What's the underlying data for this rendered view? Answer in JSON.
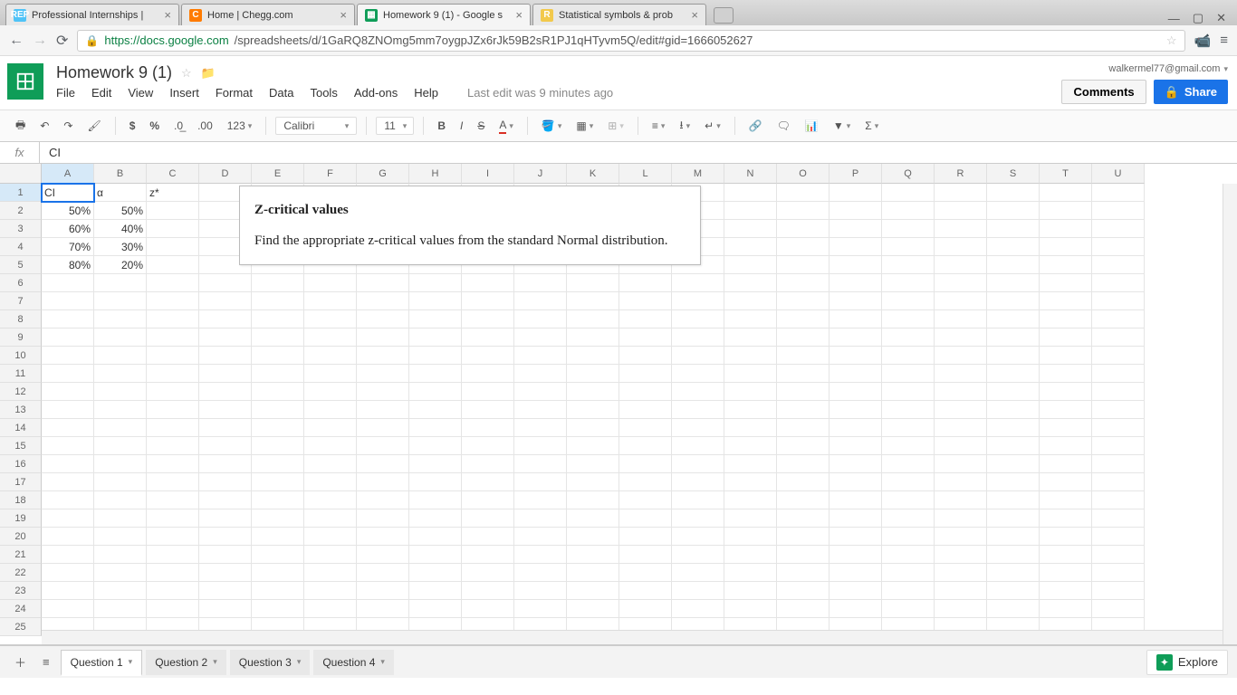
{
  "browser": {
    "tabs": [
      {
        "favicon_bg": "#4fc3f7",
        "favicon_text": "REP",
        "title": "Professional Internships |"
      },
      {
        "favicon_bg": "#ff7b00",
        "favicon_text": "C",
        "title": "Home | Chegg.com"
      },
      {
        "favicon_bg": "#0f9d58",
        "favicon_text": "▦",
        "title": "Homework 9 (1) - Google s",
        "active": true
      },
      {
        "favicon_bg": "#f2c94c",
        "favicon_text": "R",
        "title": "Statistical symbols & prob"
      }
    ],
    "url_domain": "https://docs.google.com",
    "url_path": "/spreadsheets/d/1GaRQ8ZNOmg5mm7oygpJZx6rJk59B2sR1PJ1qHTyvm5Q/edit#gid=1666052627"
  },
  "doc": {
    "title": "Homework 9 (1)",
    "menus": [
      "File",
      "Edit",
      "View",
      "Insert",
      "Format",
      "Data",
      "Tools",
      "Add-ons",
      "Help"
    ],
    "last_edit": "Last edit was 9 minutes ago",
    "account": "walkermel77@gmail.com",
    "comments_btn": "Comments",
    "share_btn": "Share"
  },
  "toolbar": {
    "font": "Calibri",
    "font_size": "11",
    "num_fmt": "123"
  },
  "formula": {
    "label": "fx",
    "value": "CI"
  },
  "grid": {
    "columns": [
      "A",
      "B",
      "C",
      "D",
      "E",
      "F",
      "G",
      "H",
      "I",
      "J",
      "K",
      "L",
      "M",
      "N",
      "O",
      "P",
      "Q",
      "R",
      "S",
      "T",
      "U"
    ],
    "row_count": 25,
    "active_cell": "A1",
    "data": {
      "1": {
        "A": "CI",
        "B": "α",
        "C": "z*"
      },
      "2": {
        "A": "50%",
        "B": "50%"
      },
      "3": {
        "A": "60%",
        "B": "40%"
      },
      "4": {
        "A": "70%",
        "B": "30%"
      },
      "5": {
        "A": "80%",
        "B": "20%"
      }
    }
  },
  "note": {
    "title": "Z-critical values",
    "body": "Find the appropriate z-critical values from the standard Normal distribution."
  },
  "sheets": {
    "tabs": [
      {
        "name": "Question 1",
        "active": true
      },
      {
        "name": "Question 2"
      },
      {
        "name": "Question 3"
      },
      {
        "name": "Question 4"
      }
    ],
    "explore": "Explore"
  }
}
